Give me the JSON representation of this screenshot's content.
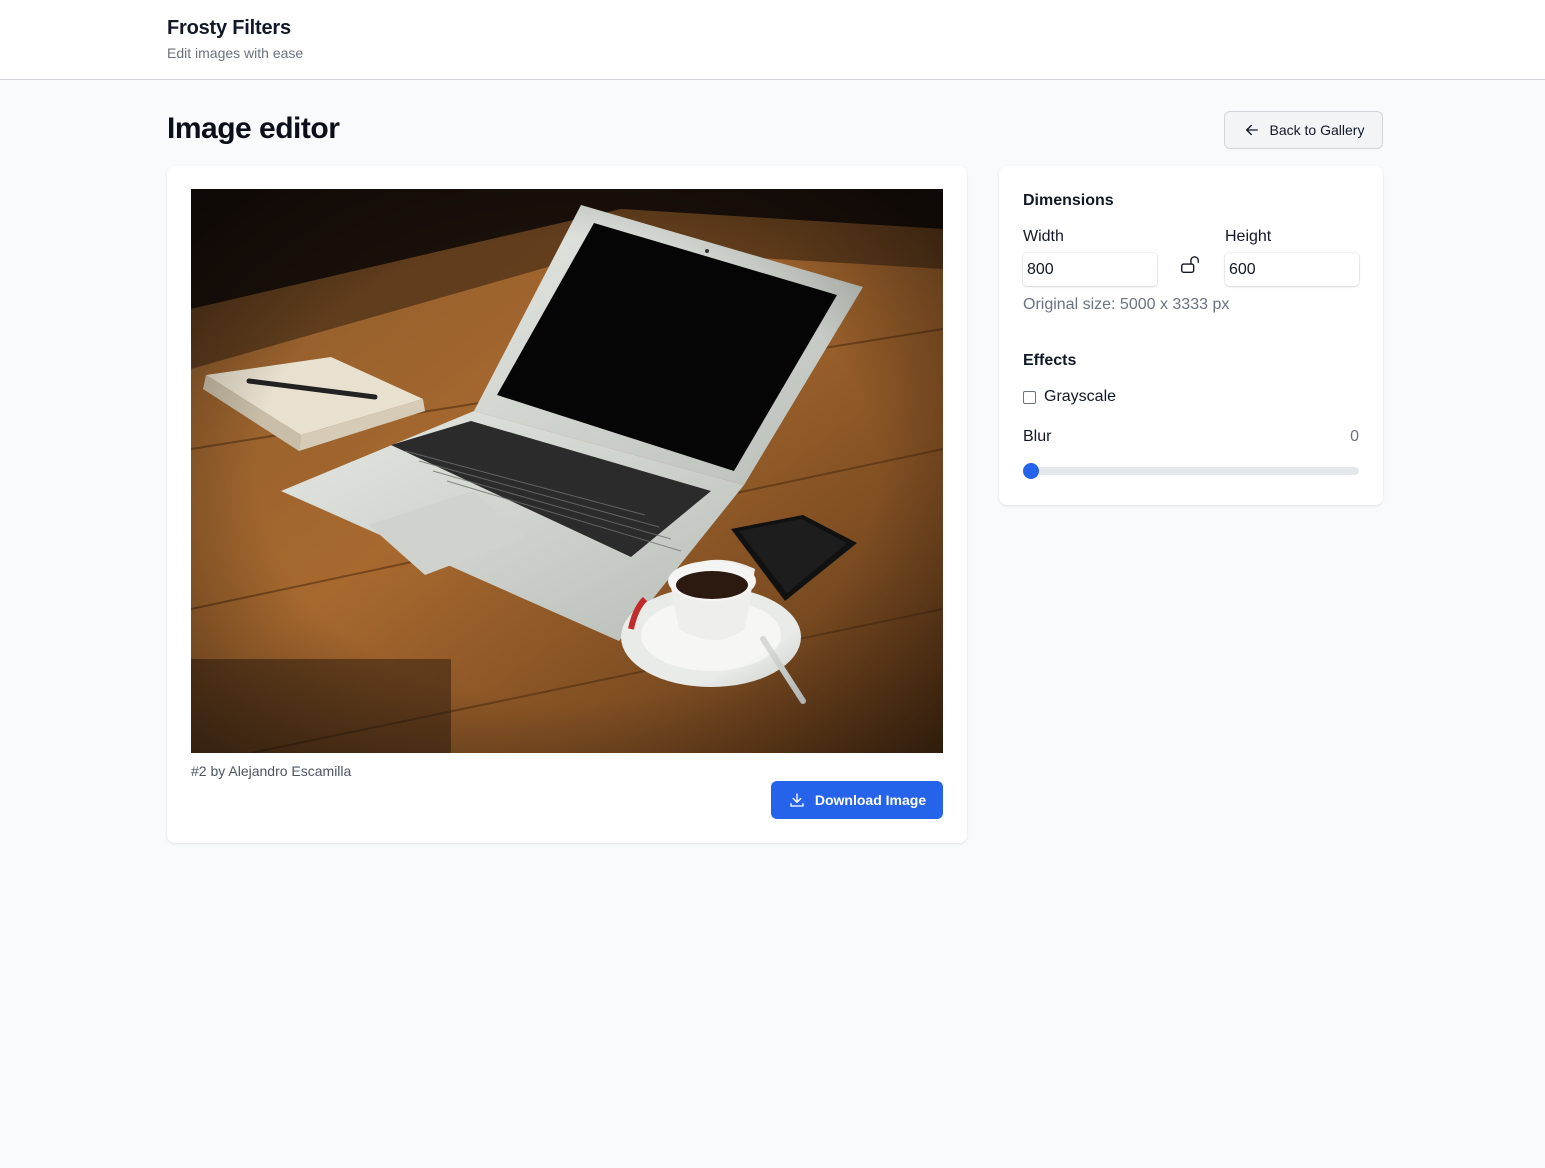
{
  "app": {
    "title": "Frosty Filters",
    "subtitle": "Edit images with ease"
  },
  "page": {
    "title": "Image editor",
    "back_label": "Back to Gallery"
  },
  "image": {
    "caption": "#2 by Alejandro Escamilla",
    "download_label": "Download Image"
  },
  "dimensions": {
    "section_title": "Dimensions",
    "width_label": "Width",
    "width_value": "800",
    "height_label": "Height",
    "height_value": "600",
    "original_size": "Original size: 5000 x 3333 px",
    "aspect_lock": "unlocked"
  },
  "effects": {
    "section_title": "Effects",
    "grayscale_label": "Grayscale",
    "grayscale_checked": false,
    "blur_label": "Blur",
    "blur_value": "0",
    "blur_fraction": 0
  },
  "colors": {
    "accent": "#2563eb",
    "background": "#f9fafb",
    "card": "#ffffff",
    "muted_text": "#6b7280"
  },
  "icons": {
    "back": "arrow-left-icon",
    "download": "download-icon",
    "lock": "unlock-icon"
  }
}
